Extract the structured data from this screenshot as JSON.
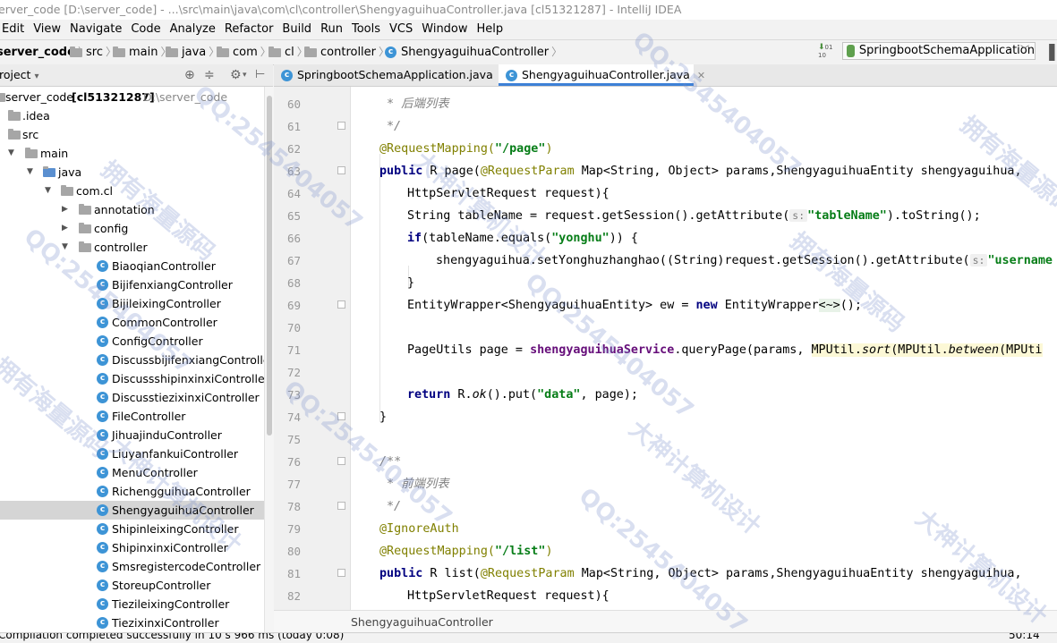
{
  "window": {
    "title": "erver_code [D:\\server_code] - ...\\src\\main\\java\\com\\cl\\controller\\ShengyaguihuaController.java [cl51321287] - IntelliJ IDEA"
  },
  "menu": [
    "Edit",
    "View",
    "Navigate",
    "Code",
    "Analyze",
    "Refactor",
    "Build",
    "Run",
    "Tools",
    "VCS",
    "Window",
    "Help"
  ],
  "breadcrumb": {
    "project": "server_code",
    "items": [
      "src",
      "main",
      "java",
      "com",
      "cl",
      "controller"
    ],
    "file": "ShengyaguihuaController"
  },
  "run_config": {
    "label": "SpringbootSchemaApplication"
  },
  "project_panel": {
    "title": "roject",
    "dropdown": "▾"
  },
  "tree": {
    "root": {
      "name": "server_code",
      "module": "[cl51321287]",
      "path": "D:\\server_code"
    },
    "idea": ".idea",
    "src": "src",
    "main": "main",
    "java": "java",
    "comcl": "com.cl",
    "annotation": "annotation",
    "config": "config",
    "controller": "controller",
    "controllers": [
      "BiaoqianController",
      "BijifenxiangController",
      "BijileixingController",
      "CommonController",
      "ConfigController",
      "DiscussbijifenxiangController",
      "DiscussshipinxinxiController",
      "DiscusstiezixinxiController",
      "FileController",
      "JihuajinduController",
      "LiuyanfankuiController",
      "MenuController",
      "RichengguihuaController",
      "ShengyaguihuaController",
      "ShipinleixingController",
      "ShipinxinxiController",
      "SmsregistercodeController",
      "StoreupController",
      "TiezileixingController",
      "TiezixinxiController"
    ],
    "selected": "ShengyaguihuaController"
  },
  "tabs": [
    {
      "label": "SpringbootSchemaApplication.java"
    },
    {
      "label": "ShengyaguihuaController.java"
    }
  ],
  "code": {
    "line_numbers": [
      "60",
      "61",
      "62",
      "63",
      "64",
      "65",
      "66",
      "67",
      "68",
      "69",
      "70",
      "71",
      "72",
      "73",
      "74",
      "75",
      "76",
      "77",
      "78",
      "79",
      "80",
      "81",
      "82"
    ],
    "l60": "* 后端列表",
    "l61": "*/",
    "l62_ann": "@RequestMapping(",
    "l62_str": "\"/page\"",
    "l62_end": ")",
    "l63_kw": "public",
    "l63_a": " R page(",
    "l63_ann": "@RequestParam",
    "l63_b": " Map<String, Object> params,ShengyaguihuaEntity shengyaguihua,",
    "l64": "HttpServletRequest request){",
    "l65_a": "String tableName = request.getSession().getAttribute(",
    "l65_hint": "s:",
    "l65_str": "\"tableName\"",
    "l65_b": ").toString();",
    "l66_kw": "if",
    "l66_a": "(tableName.equals(",
    "l66_str": "\"yonghu\"",
    "l66_b": ")) {",
    "l67_a": "shengyaguihua.setYonghuzhanghao((String)request.getSession().getAttribute(",
    "l67_hint": "s:",
    "l67_str": "\"username",
    "l68": "}",
    "l69_a": "EntityWrapper<ShengyaguihuaEntity> ew = ",
    "l69_kw": "new",
    "l69_b": " EntityWrapper",
    "l69_c": "<~>",
    "l69_d": "();",
    "l71_a": "PageUtils page = ",
    "l71_fld": "shengyaguihuaService",
    "l71_b": ".queryPage(params, ",
    "l71_c": "MPUtil.",
    "l71_d": "sort",
    "l71_e": "(MPUtil.",
    "l71_f": "between",
    "l71_g": "(MPUti",
    "l73_kw": "return",
    "l73_a": " R.",
    "l73_b": "ok",
    "l73_c": "().put(",
    "l73_str": "\"data\"",
    "l73_d": ", page);",
    "l74": "}",
    "l76": "/**",
    "l77": "* 前端列表",
    "l78": "*/",
    "l79": "@IgnoreAuth",
    "l80_ann": "@RequestMapping(",
    "l80_str": "\"/list\"",
    "l80_end": ")",
    "l81_kw": "public",
    "l81_a": " R list(",
    "l81_ann": "@RequestParam",
    "l81_b": " Map<String, Object> params,ShengyaguihuaEntity shengyaguihua,",
    "l82": "HttpServletRequest request){"
  },
  "editor_breadcrumb": "ShengyaguihuaController",
  "status": {
    "message": "Compilation completed successfully in 10 s 966 ms (today 0:08)",
    "position": "50:14"
  },
  "watermarks": [
    "QQ:2545404057",
    "大神计算机设计",
    "拥有海量源码"
  ]
}
